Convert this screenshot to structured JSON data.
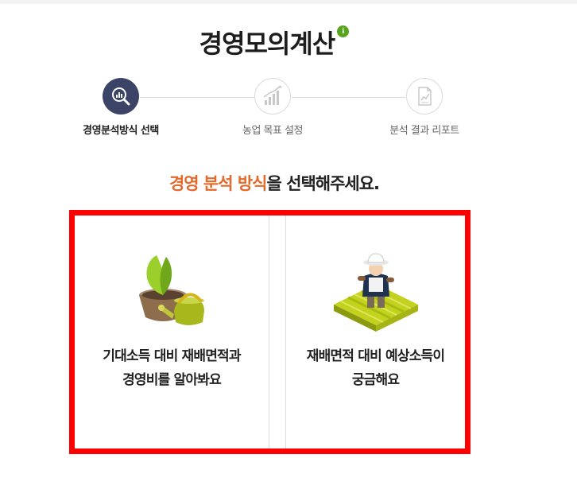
{
  "header": {
    "title": "경영모의계산",
    "info_icon": "info-icon",
    "info_glyph": "i"
  },
  "steps": [
    {
      "label": "경영분석방식 선택",
      "icon": "analysis-magnifier-icon",
      "active": true
    },
    {
      "label": "농업 목표 설정",
      "icon": "growth-chart-icon",
      "active": false
    },
    {
      "label": "분석 결과 리포트",
      "icon": "report-document-icon",
      "active": false
    }
  ],
  "prompt": {
    "highlight": "경영 분석 방식",
    "rest": "을 선택해주세요."
  },
  "options": [
    {
      "line1": "기대소득 대비 재배면적과",
      "line2": "경영비를 알아봐요",
      "icon": "sprout-watering-can-icon"
    },
    {
      "line1": "재배면적 대비 예상소득이",
      "line2": "궁금해요",
      "icon": "farmer-field-icon"
    }
  ],
  "colors": {
    "accent": "#e36a2b",
    "active_step": "#3b4466",
    "info_green": "#56a51c",
    "highlight_border": "#ff0000"
  }
}
